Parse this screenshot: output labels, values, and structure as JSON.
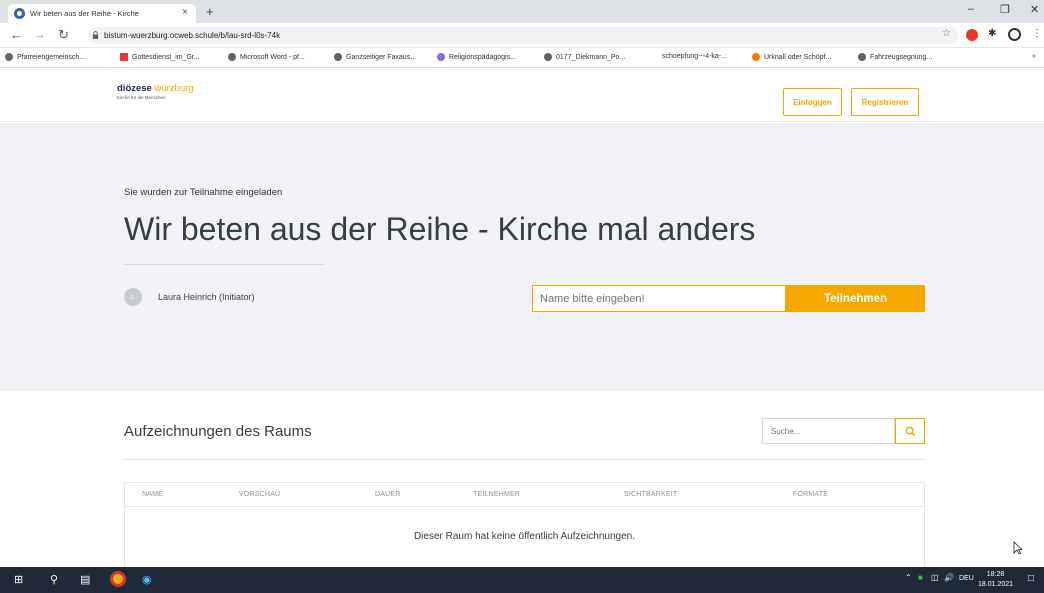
{
  "browser": {
    "tab_title": "Wir beten aus der Reihe - Kirche",
    "tab_close": "×",
    "new_tab": "+",
    "url": "bistum-wuerzburg.ocweb.schule/b/lau-srd-l0s-74k",
    "bookmarks": [
      {
        "label": "Pfarreiengemeinsch..."
      },
      {
        "label": "Gottesdienst_im_Gr..."
      },
      {
        "label": "Microsoft Word - pf..."
      },
      {
        "label": "Ganzseitiger Faxaus..."
      },
      {
        "label": "Religionspädagogis..."
      },
      {
        "label": "0177_Diekmann_Po..."
      },
      {
        "label": "schoepfung---4-ka-..."
      },
      {
        "label": "Urknall oder Schöpf..."
      },
      {
        "label": "Fahrzeugsegnung..."
      }
    ],
    "bookmarks_more": "»"
  },
  "header": {
    "logo_main": "diözese",
    "logo_accent": "würzburg",
    "logo_tagline": "Kirche für die Menschen",
    "login_label": "Einloggen",
    "register_label": "Registrieren"
  },
  "hero": {
    "invite_text": "Sie wurden zur Teilnahme eingeladen",
    "room_title": "Wir beten aus der Reihe - Kirche mal anders",
    "owner_initial": "L",
    "owner_name": "Laura Heinrich (Initiator)",
    "name_placeholder": "Name bitte eingeben!",
    "join_label": "Teilnehmen"
  },
  "recordings": {
    "title": "Aufzeichnungen des Raums",
    "search_placeholder": "Suche...",
    "columns": [
      "NAME",
      "VORSCHAU",
      "DAUER",
      "TEILNEHMER",
      "SICHTBARKEIT",
      "FORMATE"
    ],
    "empty_message": "Dieser Raum hat keine öffentlich Aufzeichnungen."
  },
  "taskbar": {
    "language": "DEU",
    "time": "18:28",
    "date": "18.01.2021"
  },
  "colors": {
    "accent": "#f5a800",
    "hero_bg": "#f0f2f5",
    "taskbar_bg": "#1f2937"
  }
}
